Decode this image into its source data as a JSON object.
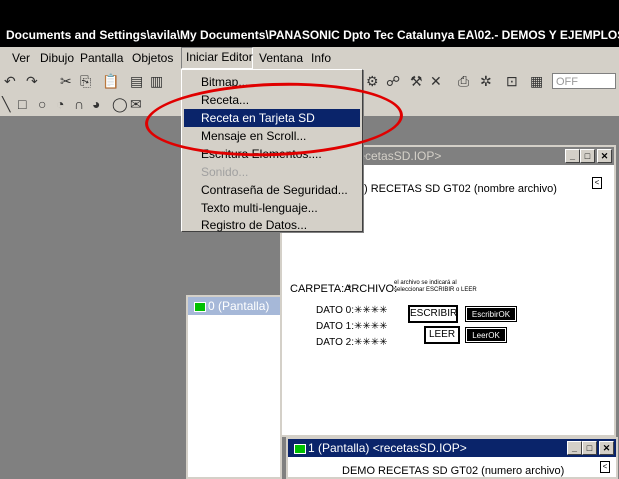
{
  "title": "Documents and Settings\\avila\\My Documents\\PANASONIC Dpto Tec Catalunya EA\\02.- DEMOS Y EJEMPLOS\\",
  "menu": [
    "Ver",
    "Dibujo",
    "Pantalla",
    "Objetos",
    "Iniciar Editor",
    "Ventana",
    "Info"
  ],
  "toolbar": {
    "off_label": "OFF"
  },
  "dropdown": {
    "items": [
      {
        "label": "Bitmap...",
        "state": "normal"
      },
      {
        "label": "Receta...",
        "state": "normal"
      },
      {
        "label": "Receta en Tarjeta SD",
        "state": "selected"
      },
      {
        "label": "Mensaje en Scroll...",
        "state": "normal"
      },
      {
        "label": "Escritura Elementos....",
        "state": "normal"
      },
      {
        "label": "Sonido...",
        "state": "disabled"
      },
      {
        "label": "Contraseña de Seguridad...",
        "state": "normal"
      },
      {
        "label": "Texto multi-lenguaje...",
        "state": "normal"
      },
      {
        "label": "Registro de Datos...",
        "state": "normal"
      }
    ]
  },
  "window_main": {
    "title": ") <recetasSD.IOP>",
    "header": ") RECETAS SD GT02 (nombre archivo)",
    "side_btn": "<",
    "carpeta": "CARPETA: *",
    "archivo": "ARCHIVO:",
    "note_line1": "el archivo se indicará al",
    "note_line2": "seleccionar ESCRIBIR o LEER",
    "dato0": "DATO 0:✳✳✳✳",
    "dato1": "DATO 1:✳✳✳✳",
    "dato2": "DATO 2:✳✳✳✳",
    "escribir": "ESCRIBIR",
    "escribir_ok": "EscribirOK",
    "leer": "LEER",
    "leer_ok": "LeerOK"
  },
  "window_0": {
    "title": "0 (Pantalla)"
  },
  "window_1": {
    "title": "1 (Pantalla) <recetasSD.IOP>",
    "header": "DEMO RECETAS SD GT02 (numero archivo)",
    "side_btn": "<"
  },
  "colors": {
    "title_active": "#0a246a",
    "highlight_ellipse": "#e00000",
    "menu_bg": "#d4d0c8"
  }
}
